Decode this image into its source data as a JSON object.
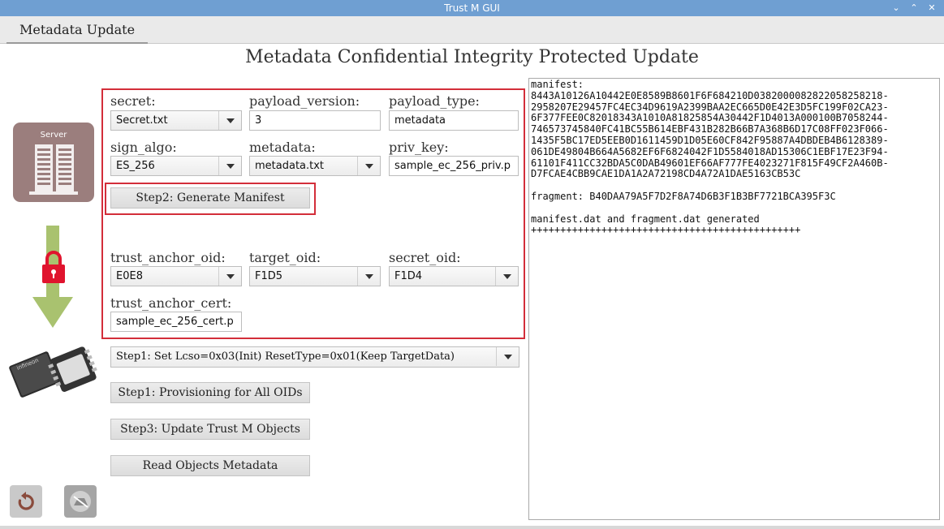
{
  "window": {
    "title": "Trust M GUI"
  },
  "tabs": [
    {
      "label": "Metadata Update"
    }
  ],
  "page_title": "Metadata Confidential Integrity Protected Update",
  "form": {
    "secret": {
      "label": "secret:",
      "value": "Secret.txt"
    },
    "payload_version": {
      "label": "payload_version:",
      "value": "3"
    },
    "payload_type": {
      "label": "payload_type:",
      "value": "metadata"
    },
    "sign_algo": {
      "label": "sign_algo:",
      "value": "ES_256"
    },
    "metadata": {
      "label": "metadata:",
      "value": "metadata.txt"
    },
    "priv_key": {
      "label": "priv_key:",
      "value": "sample_ec_256_priv.p"
    },
    "generate_manifest_button": "Step2: Generate Manifest",
    "trust_anchor_oid": {
      "label": "trust_anchor_oid:",
      "value": "E0E8"
    },
    "target_oid": {
      "label": "target_oid:",
      "value": "F1D5"
    },
    "secret_oid": {
      "label": "secret_oid:",
      "value": "F1D4"
    },
    "trust_anchor_cert": {
      "label": "trust_anchor_cert:",
      "value": "sample_ec_256_cert.p"
    }
  },
  "lcso_select": {
    "value": "Step1: Set Lcso=0x03(Init) ResetType=0x01(Keep TargetData)"
  },
  "buttons": {
    "provisioning": "Step1: Provisioning for All OIDs",
    "update_objects": "Step3: Update Trust M Objects",
    "read_metadata": "Read Objects Metadata"
  },
  "illustration": {
    "server_label": "Server",
    "chip_label": "infineon"
  },
  "output_lines": [
    "manifest:",
    "8443A10126A10442E0E8589B8601F6F684210D0382000082822058258218-",
    "2958207E29457FC4EC34D9619A2399BAA2EC665D0E42E3D5FC199F02CA23-",
    "6F377FEE0C82018343A1010A81825854A30442F1D4013A000100B7058244-",
    "746573745840FC41BC55B614EBF431B282B66B7A368B6D17C08FF023F066-",
    "1435F5BC17ED5EEB0D1611459D1D05E60CF842F95887A4DBDEB4B6128389-",
    "061DE49804B664A5682EF6F6824042F1D5584018AD15306C1EBF17E23F94-",
    "61101F411CC32BDA5C0DAB49601EF66AF777FE4023271F815F49CF2A460B-",
    "D7FCAE4CBB9CAE1DA1A2A72198CD4A72A1DAE5163CB53C",
    "",
    "fragment: B40DAA79A5F7D2F8A74D6B3F1B3BF7721BCA395F3C",
    "",
    "manifest.dat and fragment.dat generated",
    "++++++++++++++++++++++++++++++++++++++++++++++"
  ]
}
